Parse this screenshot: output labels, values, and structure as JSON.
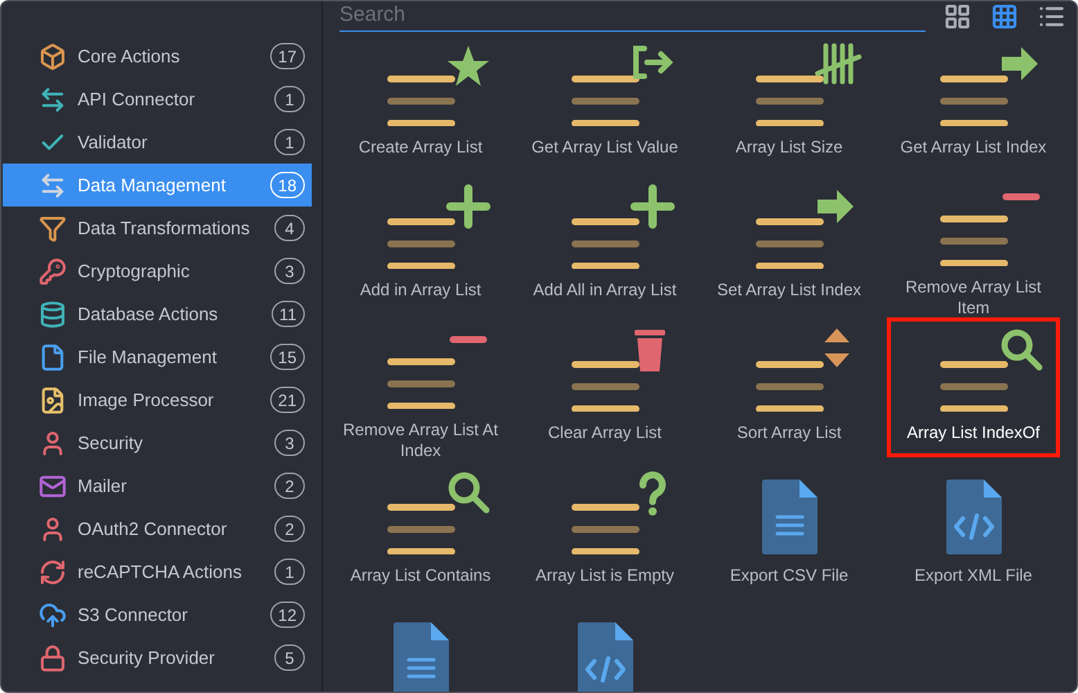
{
  "sidebar": {
    "items": [
      {
        "kind": "box",
        "label": "Core Actions",
        "count": "17",
        "selected": false
      },
      {
        "kind": "arrows",
        "label": "API Connector",
        "count": "1",
        "selected": false
      },
      {
        "kind": "check",
        "label": "Validator",
        "count": "1",
        "selected": false
      },
      {
        "kind": "arrows",
        "label": "Data Management",
        "count": "18",
        "selected": true
      },
      {
        "kind": "funnel",
        "label": "Data Transformations",
        "count": "4",
        "selected": false
      },
      {
        "kind": "key",
        "label": "Cryptographic",
        "count": "3",
        "selected": false
      },
      {
        "kind": "database",
        "label": "Database Actions",
        "count": "11",
        "selected": false
      },
      {
        "kind": "file",
        "label": "File Management",
        "count": "15",
        "selected": false
      },
      {
        "kind": "image",
        "label": "Image Processor",
        "count": "21",
        "selected": false
      },
      {
        "kind": "person",
        "label": "Security",
        "count": "3",
        "selected": false
      },
      {
        "kind": "mail",
        "label": "Mailer",
        "count": "2",
        "selected": false
      },
      {
        "kind": "person",
        "label": "OAuth2 Connector",
        "count": "2",
        "selected": false
      },
      {
        "kind": "refresh",
        "label": "reCAPTCHA Actions",
        "count": "1",
        "selected": false
      },
      {
        "kind": "cloud",
        "label": "S3 Connector",
        "count": "12",
        "selected": false
      },
      {
        "kind": "lock",
        "label": "Security Provider",
        "count": "5",
        "selected": false
      }
    ]
  },
  "search": {
    "placeholder": "Search"
  },
  "view_modes": [
    {
      "kind": "large",
      "selected": false
    },
    {
      "kind": "small",
      "selected": true
    },
    {
      "kind": "list",
      "selected": false
    }
  ],
  "actions": [
    {
      "kind": "star",
      "label": "Create Array List",
      "selected": false
    },
    {
      "kind": "exit",
      "label": "Get Array List Value",
      "selected": false
    },
    {
      "kind": "tally",
      "label": "Array List Size",
      "selected": false
    },
    {
      "kind": "arrow",
      "label": "Get Array List Index",
      "selected": false
    },
    {
      "kind": "plus",
      "label": "Add in Array List",
      "selected": false
    },
    {
      "kind": "plus",
      "label": "Add All in Array List",
      "selected": false
    },
    {
      "kind": "arrow",
      "label": "Set Array List Index",
      "selected": false
    },
    {
      "kind": "minus",
      "label": "Remove Array List Item",
      "selected": false
    },
    {
      "kind": "minus",
      "label": "Remove Array List At Index",
      "selected": false
    },
    {
      "kind": "trash",
      "label": "Clear Array List",
      "selected": false
    },
    {
      "kind": "sort",
      "label": "Sort Array List",
      "selected": false
    },
    {
      "kind": "search",
      "label": "Array List IndexOf",
      "selected": true
    },
    {
      "kind": "search",
      "label": "Array List Contains",
      "selected": false
    },
    {
      "kind": "question",
      "label": "Array List is Empty",
      "selected": false
    },
    {
      "kind": "file-lines",
      "label": "Export CSV File",
      "selected": false
    },
    {
      "kind": "file-code",
      "label": "Export XML File",
      "selected": false
    },
    {
      "kind": "file-lines",
      "selected": false
    },
    {
      "kind": "file-code",
      "selected": false
    }
  ]
}
